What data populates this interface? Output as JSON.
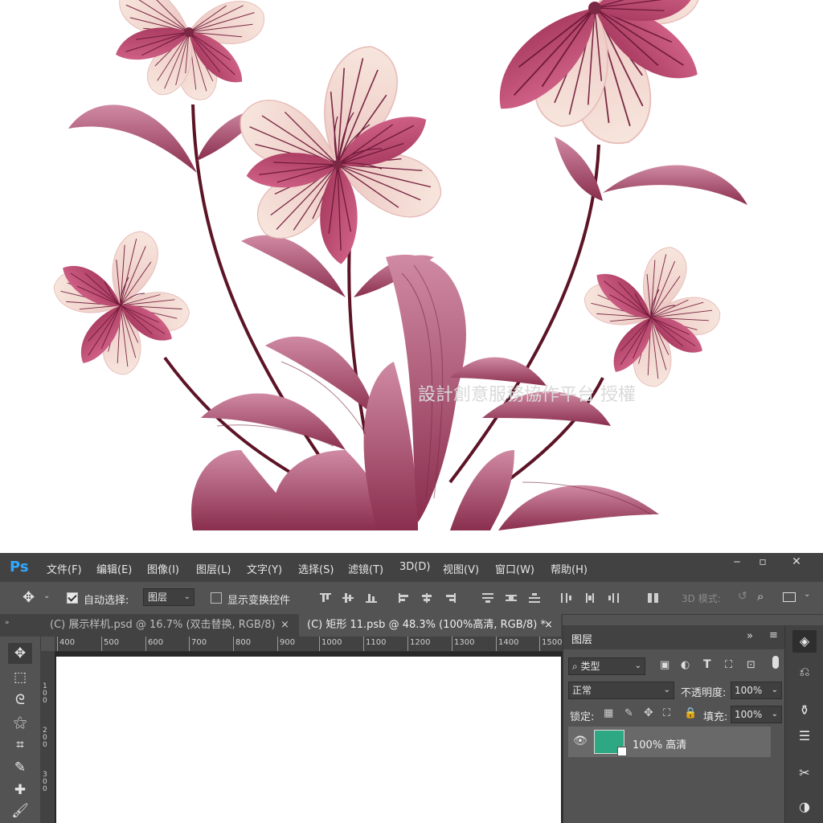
{
  "artwork": {
    "watermark": "設計創意服務協作平台 授權",
    "colors": {
      "petal_dark": "#c4587d",
      "petal_light": "#f6e3da",
      "stem": "#5c1426",
      "leaf": "#b55277"
    }
  },
  "app": {
    "logo": "Ps"
  },
  "menu": [
    "文件(F)",
    "编辑(E)",
    "图像(I)",
    "图层(L)",
    "文字(Y)",
    "选择(S)",
    "滤镜(T)",
    "3D(D)",
    "视图(V)",
    "窗口(W)",
    "帮助(H)"
  ],
  "window_controls": {
    "minimize": "‒",
    "maximize": "▫",
    "close": "✕"
  },
  "options": {
    "auto_select_label": "自动选择:",
    "auto_select_value": "图层",
    "show_transform_label": "显示变换控件",
    "mode_3d": "3D 模式:"
  },
  "tabs": [
    {
      "label": "(C) 展示样机.psd @ 16.7% (双击替换, RGB/8)",
      "close": "×"
    },
    {
      "label": "(C) 矩形 11.psb @ 48.3% (100%高清, RGB/8) *",
      "close": "×"
    }
  ],
  "ruler_h": [
    "400",
    "500",
    "600",
    "700",
    "800",
    "900",
    "1000",
    "1100",
    "1200",
    "1300",
    "1400",
    "1500"
  ],
  "ruler_v": [
    "100",
    "200",
    "300"
  ],
  "layers_panel": {
    "title": "图层",
    "filter_label": "类型",
    "blend_mode": "正常",
    "opacity_label": "不透明度:",
    "opacity_value": "100%",
    "lock_label": "锁定:",
    "fill_label": "填充:",
    "fill_value": "100%",
    "layers": [
      {
        "name": "100% 高清",
        "thumb_color": "#2ea783"
      }
    ]
  }
}
